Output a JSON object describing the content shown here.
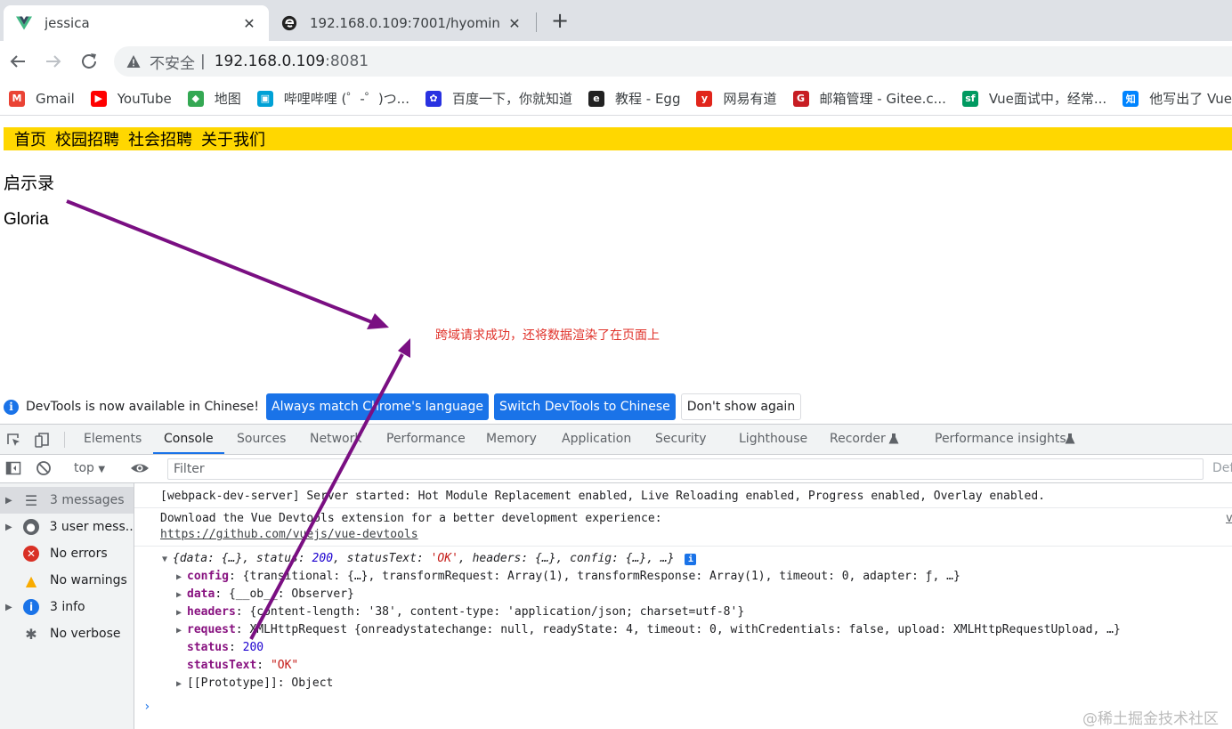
{
  "browser": {
    "tabs": [
      {
        "title": "jessica",
        "icon": "vue-icon",
        "active": true
      },
      {
        "title": "192.168.0.109:7001/hyomin",
        "icon": "egg-icon",
        "active": false
      }
    ],
    "close_glyph": "✕",
    "newtab_glyph": "+",
    "address": {
      "insecure_label": "不安全",
      "separator": "|",
      "host": "192.168.0.109",
      "port": ":8081"
    },
    "bookmarks": [
      {
        "label": "Gmail",
        "icon": "gmail-icon",
        "color": "#ea4335",
        "glyph": "M"
      },
      {
        "label": "YouTube",
        "icon": "youtube-icon",
        "color": "#ff0000",
        "glyph": "▶"
      },
      {
        "label": "地图",
        "icon": "maps-icon",
        "color": "#34a853",
        "glyph": "◆"
      },
      {
        "label": "哔哩哔哩 (゜-゜)つ...",
        "icon": "bilibili-icon",
        "color": "#00a1d6",
        "glyph": "▣"
      },
      {
        "label": "百度一下，你就知道",
        "icon": "baidu-icon",
        "color": "#2932e1",
        "glyph": "✿"
      },
      {
        "label": "教程 - Egg",
        "icon": "egg-icon",
        "color": "#222222",
        "glyph": "e"
      },
      {
        "label": "网易有道",
        "icon": "youdao-icon",
        "color": "#e1251b",
        "glyph": "y"
      },
      {
        "label": "邮箱管理 - Gitee.c...",
        "icon": "gitee-icon",
        "color": "#c71d23",
        "glyph": "G"
      },
      {
        "label": "Vue面试中，经常...",
        "icon": "segmentfault-icon",
        "color": "#009a61",
        "glyph": "sf"
      },
      {
        "label": "他写出了 Vue",
        "icon": "zhihu-icon",
        "color": "#0084ff",
        "glyph": "知"
      }
    ]
  },
  "page": {
    "nav": [
      "首页",
      "校园招聘",
      "社会招聘",
      "关于我们"
    ],
    "items": [
      "启示录",
      "Gloria"
    ],
    "annotation": "跨域请求成功，还将数据渲染了在页面上",
    "annotation_color": "#e0322a",
    "arrow_color": "#7a0f82"
  },
  "devtools": {
    "lang_bar": {
      "message": "DevTools is now available in Chinese!",
      "buttons": [
        "Always match Chrome's language",
        "Switch DevTools to Chinese",
        "Don't show again"
      ]
    },
    "tabs": [
      "Elements",
      "Console",
      "Sources",
      "Network",
      "Performance",
      "Memory",
      "Application",
      "Security",
      "Lighthouse",
      "Recorder",
      "Performance insights"
    ],
    "active_tab": "Console",
    "console_toolbar": {
      "context": "top",
      "filter_placeholder": "Filter",
      "levels": "Def"
    },
    "sidebar": [
      {
        "label": "3 messages",
        "icon": "list-icon",
        "caret": true,
        "selected": true
      },
      {
        "label": "3 user mess...",
        "icon": "user-icon",
        "caret": true,
        "selected": false
      },
      {
        "label": "No errors",
        "icon": "error-icon",
        "caret": false,
        "selected": false
      },
      {
        "label": "No warnings",
        "icon": "warning-icon",
        "caret": false,
        "selected": false
      },
      {
        "label": "3 info",
        "icon": "info-icon",
        "caret": true,
        "selected": false
      },
      {
        "label": "No verbose",
        "icon": "bug-icon",
        "caret": false,
        "selected": false
      }
    ],
    "log": {
      "line1": "[webpack-dev-server] Server started: Hot Module Replacement enabled, Live Reloading enabled, Progress enabled, Overlay enabled.",
      "line2": "Download the Vue Devtools extension for a better development experience:",
      "line2_link": "https://github.com/vuejs/vue-devtools",
      "line2_source": "v",
      "object_summary": "{data: {…}, status: 200, statusText: 'OK', headers: {…}, config: {…}, …}",
      "props": [
        {
          "key": "config",
          "value": "{transitional: {…}, transformRequest: Array(1), transformResponse: Array(1), timeout: 0, adapter: ƒ, …}",
          "expandable": true
        },
        {
          "key": "data",
          "value": "{__ob__: Observer}",
          "expandable": true
        },
        {
          "key": "headers",
          "value": "{content-length: '38', content-type: 'application/json; charset=utf-8'}",
          "expandable": true
        },
        {
          "key": "request",
          "value": "XMLHttpRequest {onreadystatechange: null, readyState: 4, timeout: 0, withCredentials: false, upload: XMLHttpRequestUpload, …}",
          "expandable": true
        },
        {
          "key": "status",
          "value": "200",
          "expandable": false
        },
        {
          "key": "statusText",
          "value": "\"OK\"",
          "expandable": false
        },
        {
          "key": "[[Prototype]]",
          "value": "Object",
          "expandable": true
        }
      ],
      "prompt": "›"
    }
  },
  "watermark": "@稀土掘金技术社区"
}
